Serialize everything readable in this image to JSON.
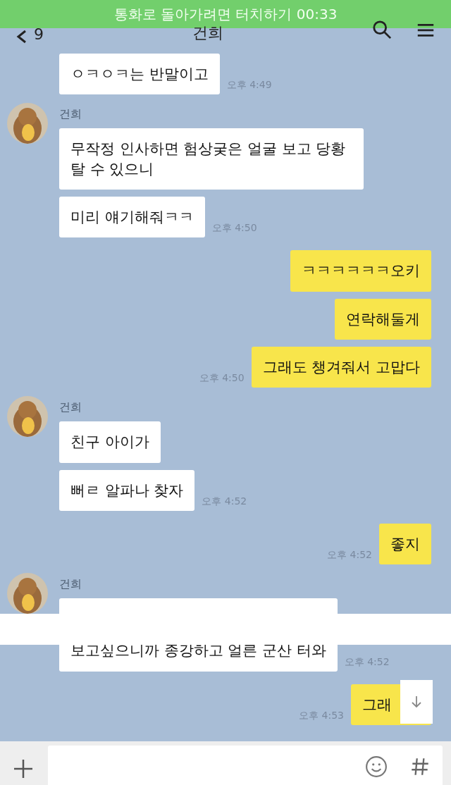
{
  "call_banner": {
    "text": "통화로 돌아가려면 터치하기 00:33"
  },
  "header": {
    "back_count": "9",
    "title": "건희"
  },
  "groups": [
    {
      "kind": "in",
      "messages": [
        {
          "kind": "text",
          "text": "ㅇㅋㅇㅋ는 반말이고",
          "time": "오후 4:49"
        }
      ]
    },
    {
      "kind": "in",
      "sender": "건희",
      "messages": [
        {
          "kind": "text",
          "text": "무작정 인사하면 험상궂은 얼굴 보고 당황 탈 수 있으니"
        },
        {
          "kind": "text",
          "text": "미리 얘기해줘ㅋㅋ",
          "time": "오후 4:50"
        }
      ]
    },
    {
      "kind": "out",
      "messages": [
        {
          "kind": "text",
          "text": "ㅋㅋㅋㅋㅋㅋ오키"
        },
        {
          "kind": "text",
          "text": "연락해둘게"
        },
        {
          "kind": "text",
          "text": "그래도 챙겨줘서 고맙다",
          "time": "오후 4:50"
        }
      ]
    },
    {
      "kind": "in",
      "sender": "건희",
      "messages": [
        {
          "kind": "text",
          "text": "친구 아이가"
        },
        {
          "kind": "text",
          "text": "뻐ㄹ 알파나 찾자",
          "time": "오후 4:52"
        }
      ]
    },
    {
      "kind": "out",
      "messages": [
        {
          "kind": "text",
          "text": "좋지",
          "time": "오후 4:52"
        }
      ]
    },
    {
      "kind": "in",
      "sender": "건희",
      "messages": [
        {
          "kind": "cut",
          "text": "보고싶으니까 종강하고 얼른 군산 터와",
          "time": "오후 4:52"
        }
      ]
    },
    {
      "kind": "out",
      "messages": [
        {
          "kind": "text",
          "text": "그래",
          "time": "오후 4:53"
        }
      ]
    }
  ],
  "scroll_down_button": true
}
